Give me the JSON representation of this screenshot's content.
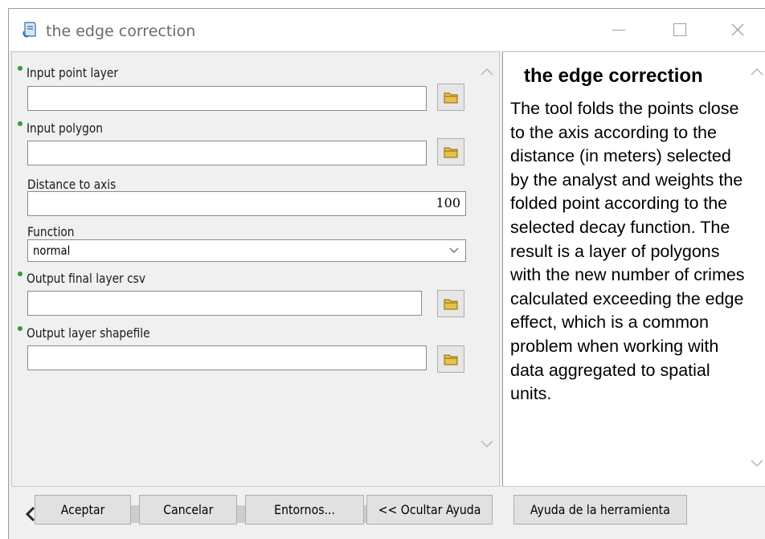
{
  "window": {
    "title": "the edge correction",
    "controls": [
      "minimize-icon",
      "maximize-icon",
      "close-icon"
    ]
  },
  "form": {
    "fields": [
      {
        "label": "Input point layer",
        "required": true,
        "value": "",
        "type": "file"
      },
      {
        "label": "Input polygon",
        "required": true,
        "value": "",
        "type": "file"
      },
      {
        "label": "Distance to axis",
        "required": false,
        "value": "100",
        "type": "number"
      },
      {
        "label": "Function",
        "required": false,
        "value": "normal",
        "type": "select"
      },
      {
        "label": "Output final layer csv",
        "required": true,
        "value": "",
        "type": "file"
      },
      {
        "label": "Output layer shapefile",
        "required": true,
        "value": "",
        "type": "file"
      }
    ]
  },
  "help": {
    "title": "the edge correction",
    "body": "The tool folds the points close to the axis according to the distance (in meters) selected by the analyst and weights the folded point according to the selected decay function. The result is a layer of polygons with the new number of crimes calculated exceeding the edge effect, which is a common problem when working with data aggregated to spatial units."
  },
  "buttons": {
    "ok": "Aceptar",
    "cancel": "Cancelar",
    "environments": "Entornos...",
    "hide_help": "<< Ocultar Ayuda",
    "tool_help": "Ayuda de la herramienta"
  },
  "colors": {
    "required_dot": "#2e9b3a",
    "folder_icon": "#e8c04a"
  }
}
